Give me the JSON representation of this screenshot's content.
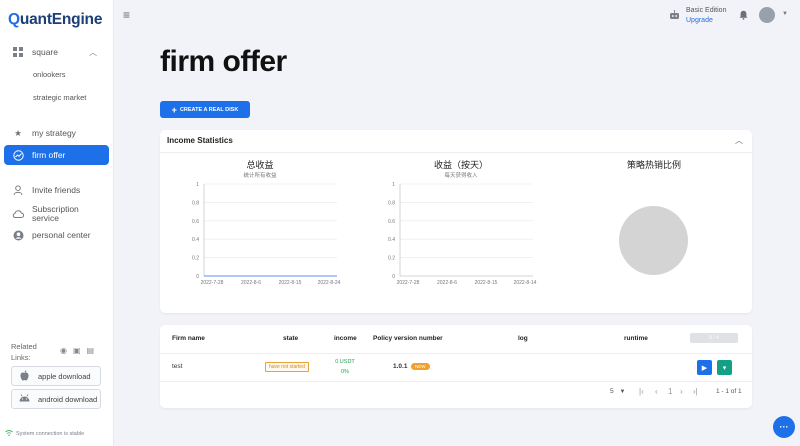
{
  "app": {
    "logo_q": "Q",
    "logo_rest": "uantEngine"
  },
  "sidebar": {
    "square": "square",
    "sub_items": [
      "onlookers",
      "strategic market"
    ],
    "my_strategy": "my strategy",
    "firm_offer": "firm offer",
    "invite_friends": "Invite friends",
    "subscription_1": "Subscription",
    "subscription_2": "service",
    "personal_center": "personal center",
    "related_1": "Related",
    "related_2": "Links:",
    "apple_download": "apple download",
    "android_download": "android download",
    "connection_status": "System connection is stable"
  },
  "header": {
    "edition": "Basic Edition",
    "upgrade": "Upgrade"
  },
  "page": {
    "title": "firm offer",
    "create_button": "CREATE A REAL DISK"
  },
  "income_card": {
    "title": "Income Statistics",
    "charts": [
      {
        "title": "总收益",
        "subtitle": "统计所有收益"
      },
      {
        "title": "收益（按天）",
        "subtitle": "每天获得收入"
      },
      {
        "title": "策略热销比例",
        "subtitle": ""
      }
    ]
  },
  "chart_data": [
    {
      "type": "line",
      "title": "总收益",
      "subtitle": "统计所有收益",
      "x": [
        "2022-7-28",
        "2022-8-6",
        "2022-8-15",
        "2022-8-24"
      ],
      "y_ticks": [
        "0",
        "0.2",
        "0.4",
        "0.6",
        "0.8",
        "1"
      ],
      "ylim": [
        0,
        1
      ],
      "series": [
        {
          "values": [
            0,
            0,
            0,
            0
          ]
        }
      ],
      "colors": [
        "#5b8ff9"
      ]
    },
    {
      "type": "line",
      "title": "收益（按天）",
      "subtitle": "每天获得收入",
      "x": [
        "2022-7-28",
        "2022-8-6",
        "2022-8-15",
        "2022-8-14"
      ],
      "y_ticks": [
        "0",
        "0.2",
        "0.4",
        "0.6",
        "0.8",
        "1"
      ],
      "ylim": [
        0,
        1
      ],
      "series": [],
      "colors": [
        "#5b8ff9"
      ]
    },
    {
      "type": "pie",
      "title": "策略热销比例",
      "values": [],
      "colors": [
        "#d4d4d4"
      ]
    }
  ],
  "table": {
    "headers": [
      "Firm name",
      "state",
      "income",
      "Policy version number",
      "log",
      "runtime"
    ],
    "header_chip": "0 / 4",
    "rows": [
      {
        "firm_name": "test",
        "state": "have not started",
        "income_usdt": "0 USDT",
        "income_pct": "0%",
        "version": "1.0.1",
        "version_badge": "NEW"
      }
    ],
    "page_size": "5",
    "range": "1 - 1 of 1"
  },
  "colors": {
    "accent": "#1e70e8",
    "success": "#22a34a",
    "warning": "#e6a23c",
    "action_green": "#14a085"
  }
}
